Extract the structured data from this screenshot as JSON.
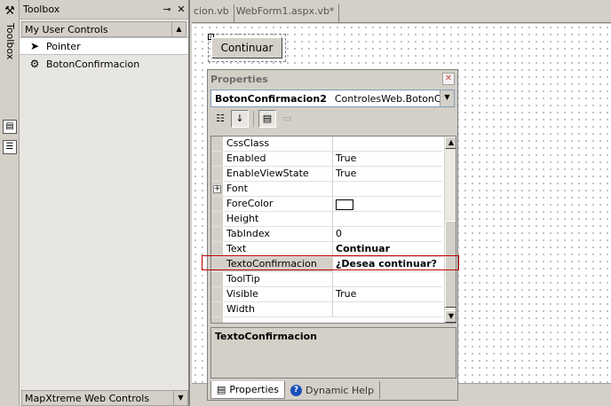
{
  "left_strip": {
    "label": "Toolbox"
  },
  "toolbox": {
    "title": "Toolbox",
    "pin": "⊸",
    "close": "✕",
    "group": "My User Controls",
    "items": [
      {
        "label": "Pointer",
        "icon": "pointer-icon"
      },
      {
        "label": "BotonConfirmacion",
        "icon": "gear-icon"
      }
    ],
    "bottom_group": "MapXtreme Web Controls"
  },
  "doc_tabs": [
    "cion.vb",
    "WebForm1.aspx.vb*"
  ],
  "designer": {
    "button_text": "Continuar"
  },
  "properties": {
    "title": "Properties",
    "object_name": "BotonConfirmacion2",
    "object_type": "ControlesWeb.BotonConfi",
    "rows": [
      {
        "name": "CssClass",
        "value": "",
        "bold": false
      },
      {
        "name": "Enabled",
        "value": "True",
        "bold": false
      },
      {
        "name": "EnableViewState",
        "value": "True",
        "bold": false
      },
      {
        "name": "Font",
        "value": "",
        "bold": false,
        "expandable": true
      },
      {
        "name": "ForeColor",
        "value": "",
        "bold": false,
        "swatch": "#ffffff"
      },
      {
        "name": "Height",
        "value": "",
        "bold": false
      },
      {
        "name": "TabIndex",
        "value": "0",
        "bold": false
      },
      {
        "name": "Text",
        "value": "Continuar",
        "bold": true
      },
      {
        "name": "TextoConfirmacion",
        "value": "¿Desea continuar?",
        "bold": true,
        "selected": true
      },
      {
        "name": "ToolTip",
        "value": "",
        "bold": false
      },
      {
        "name": "Visible",
        "value": "True",
        "bold": false
      },
      {
        "name": "Width",
        "value": "",
        "bold": false
      }
    ],
    "description": "TextoConfirmacion",
    "tabs": [
      "Properties",
      "Dynamic Help"
    ]
  },
  "colors": {
    "highlight": "#c00000",
    "selection": "#d4d0c8"
  }
}
